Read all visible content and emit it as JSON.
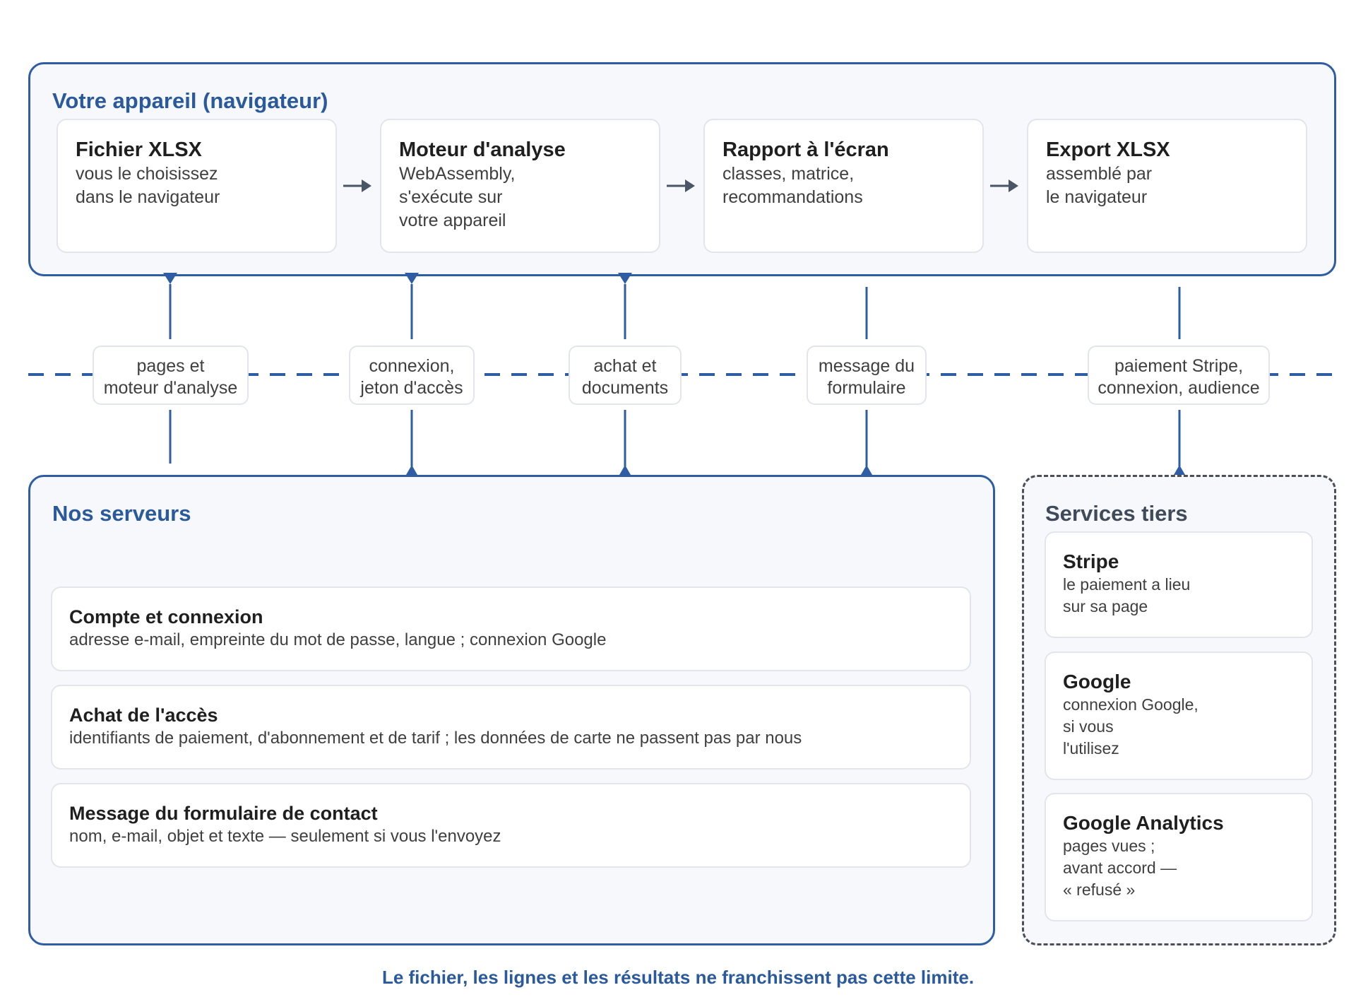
{
  "device_zone": {
    "title": "Votre appareil (navigateur)",
    "cards": [
      {
        "title": "Fichier XLSX",
        "lines": [
          "vous le choisissez",
          "dans le navigateur"
        ]
      },
      {
        "title": "Moteur d'analyse",
        "lines": [
          "WebAssembly,",
          "s'exécute sur",
          "votre appareil"
        ]
      },
      {
        "title": "Rapport à l'écran",
        "lines": [
          "classes, matrice,",
          "recommandations"
        ]
      },
      {
        "title": "Export XLSX",
        "lines": [
          "assemblé par",
          "le navigateur"
        ]
      }
    ]
  },
  "boundary_labels": [
    {
      "lines": [
        "pages et",
        "moteur d'analyse"
      ]
    },
    {
      "lines": [
        "connexion,",
        "jeton d'accès"
      ]
    },
    {
      "lines": [
        "achat et",
        "documents"
      ]
    },
    {
      "lines": [
        "message du",
        "formulaire"
      ]
    },
    {
      "lines": [
        "paiement Stripe,",
        "connexion, audience"
      ]
    }
  ],
  "servers_zone": {
    "title": "Nos serveurs",
    "rows": [
      {
        "title": "Compte et connexion",
        "line": "adresse e-mail, empreinte du mot de passe, langue ; connexion Google"
      },
      {
        "title": "Achat de l'accès",
        "line": "identifiants de paiement, d'abonnement et de tarif ; les données de carte ne passent pas par nous"
      },
      {
        "title": "Message du formulaire de contact",
        "line": "nom, e-mail, objet et texte — seulement si vous l'envoyez"
      }
    ]
  },
  "third_party_zone": {
    "title": "Services tiers",
    "services": [
      {
        "title": "Stripe",
        "lines": [
          "le paiement a lieu",
          "sur sa page"
        ]
      },
      {
        "title": "Google",
        "lines": [
          "connexion Google,",
          "si vous",
          "l'utilisez"
        ]
      },
      {
        "title": "Google Analytics",
        "lines": [
          "pages vues ;",
          "avant accord —",
          "« refusé »"
        ]
      }
    ]
  },
  "footer": "Le fichier, les lignes et les résultats ne franchissent pas cette limite.",
  "colors": {
    "accent": "#2f5da3",
    "arrow_gray": "#4a5566",
    "zone_bg": "#f6f8fb"
  }
}
